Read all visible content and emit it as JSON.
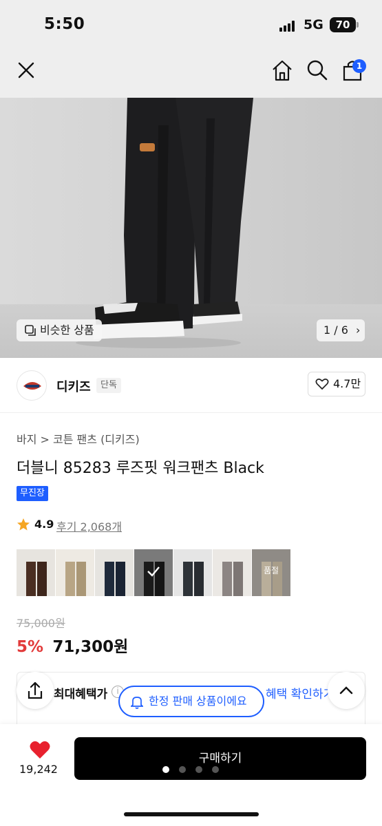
{
  "status_bar": {
    "time": "5:50",
    "network": "5G",
    "battery": "70"
  },
  "nav": {
    "cart_count": "1"
  },
  "hero": {
    "similar_label": "비슷한 상품",
    "pager": "1 / 6"
  },
  "brand": {
    "name": "디키즈",
    "tag": "단독",
    "likes": "4.7만"
  },
  "product": {
    "breadcrumb": "바지 > 코튼 팬츠 (디키즈)",
    "title": "더블니 85283 루즈핏 워크팬츠 Black",
    "badge": "무진장",
    "rating": "4.9",
    "reviews": "후기 2,068개",
    "swatch_soldout": "품절",
    "original_price": "75,000원",
    "discount": "5%",
    "price": "71,300원"
  },
  "benefit": {
    "label": "최대혜택가",
    "link": "혜택 확인하기",
    "limited_notice": "한정 판매 상품이에요"
  },
  "bottom": {
    "like_count": "19,242",
    "buy_label": "구매하기"
  },
  "colors": {
    "accent": "#1e5eff",
    "discount": "#e23b3b",
    "star": "#f5a623",
    "heart": "#e8212e"
  }
}
